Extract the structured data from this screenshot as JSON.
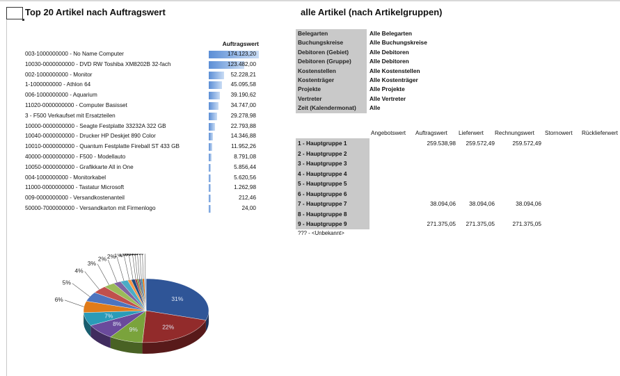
{
  "titles": {
    "left": "Top 20 Artikel nach Auftragswert",
    "right": "alle Artikel (nach Artikelgruppen)"
  },
  "top20": {
    "column_header": "Auftragswert",
    "rows": [
      {
        "label": "003-1000000000 - No Name Computer",
        "value": "174.123,20",
        "amount": 174123.2
      },
      {
        "label": "10030-0000000000 - DVD RW Toshiba XM8202B 32-fach",
        "value": "123.482,00",
        "amount": 123482.0
      },
      {
        "label": "002-1000000000 - Monitor",
        "value": "52.228,21",
        "amount": 52228.21
      },
      {
        "label": "1-1000000000 - Athlon 64",
        "value": "45.095,58",
        "amount": 45095.58
      },
      {
        "label": "006-1000000000 - Aquarium",
        "value": "39.190,62",
        "amount": 39190.62
      },
      {
        "label": "11020-0000000000 - Computer Basisset",
        "value": "34.747,00",
        "amount": 34747.0
      },
      {
        "label": "3 - F500 Verkaufset mit Ersatzteilen",
        "value": "29.278,98",
        "amount": 29278.98
      },
      {
        "label": "10000-0000000000 - Seagte Festplatte 33232A 322 GB",
        "value": "22.793,88",
        "amount": 22793.88
      },
      {
        "label": "10040-0000000000 - Drucker HP Deskjet 890 Color",
        "value": "14.346,88",
        "amount": 14346.88
      },
      {
        "label": "10010-0000000000 - Quantum Festplatte Fireball ST 433 GB",
        "value": "11.952,26",
        "amount": 11952.26
      },
      {
        "label": "40000-0000000000 - F500 - Modellauto",
        "value": "8.791,08",
        "amount": 8791.08
      },
      {
        "label": "10050-0000000000 - Grafikkarte All in One",
        "value": "5.856,44",
        "amount": 5856.44
      },
      {
        "label": "004-1000000000 - Monitorkabel",
        "value": "5.620,56",
        "amount": 5620.56
      },
      {
        "label": "11000-0000000000 - Tastatur Microsoft",
        "value": "1.262,98",
        "amount": 1262.98
      },
      {
        "label": "009-0000000000 - Versandkostenanteil",
        "value": "212,46",
        "amount": 212.46
      },
      {
        "label": "50000-7000000000 - Versandkarton mit Firmenlogo",
        "value": "24,00",
        "amount": 24.0
      }
    ]
  },
  "filters": [
    {
      "key": "Belegarten",
      "value": "Alle Belegarten"
    },
    {
      "key": "Buchungskreise",
      "value": "Alle Buchungskreise"
    },
    {
      "key": "Debitoren (Gebiet)",
      "value": "Alle Debitoren"
    },
    {
      "key": "Debitoren (Gruppe)",
      "value": "Alle Debitoren"
    },
    {
      "key": "Kostenstellen",
      "value": "Alle Kostenstellen"
    },
    {
      "key": "Kostenträger",
      "value": "Alle Kostenträger"
    },
    {
      "key": "Projekte",
      "value": "Alle Projekte"
    },
    {
      "key": "Vertreter",
      "value": "Alle Vertreter"
    },
    {
      "key": "Zeit (Kalendermonat)",
      "value": "Alle"
    }
  ],
  "groups_table": {
    "columns": [
      "Angebotswert",
      "Auftragswert",
      "Lieferwert",
      "Rechnungswert",
      "Stornowert",
      "Rücklieferwert"
    ],
    "rows": [
      {
        "name": "1 - Hauptgruppe 1",
        "auftragswert": "259.538,98",
        "lieferwert": "259.572,49",
        "rechnungswert": "259.572,49"
      },
      {
        "name": "2 - Hauptgruppe 2",
        "auftragswert": "",
        "lieferwert": "",
        "rechnungswert": ""
      },
      {
        "name": "3 - Hauptgruppe 3",
        "auftragswert": "",
        "lieferwert": "",
        "rechnungswert": ""
      },
      {
        "name": "4 - Hauptgruppe 4",
        "auftragswert": "",
        "lieferwert": "",
        "rechnungswert": ""
      },
      {
        "name": "5 - Hauptgruppe 5",
        "auftragswert": "",
        "lieferwert": "",
        "rechnungswert": ""
      },
      {
        "name": "6 - Hauptgruppe 6",
        "auftragswert": "",
        "lieferwert": "",
        "rechnungswert": ""
      },
      {
        "name": "7 - Hauptgruppe 7",
        "auftragswert": "38.094,06",
        "lieferwert": "38.094,06",
        "rechnungswert": "38.094,06"
      },
      {
        "name": "8 - Hauptgruppe 8",
        "auftragswert": "",
        "lieferwert": "",
        "rechnungswert": ""
      },
      {
        "name": "9 - Hauptgruppe 9",
        "auftragswert": "271.375,05",
        "lieferwert": "271.375,05",
        "rechnungswert": "271.375,05"
      }
    ],
    "unknown_row": "??? - <Unbekannt>"
  },
  "chart_data": {
    "type": "pie",
    "title": "",
    "slices": [
      {
        "label": "31%",
        "value": 31,
        "color": "#2f5597"
      },
      {
        "label": "22%",
        "value": 22,
        "color": "#922b2b"
      },
      {
        "label": "9%",
        "value": 9,
        "color": "#7aa33c"
      },
      {
        "label": "8%",
        "value": 8,
        "color": "#6a4a9c"
      },
      {
        "label": "7%",
        "value": 7,
        "color": "#2a9bb8"
      },
      {
        "label": "6%",
        "value": 6,
        "color": "#e07b1a"
      },
      {
        "label": "5%",
        "value": 5,
        "color": "#4d74bf"
      },
      {
        "label": "4%",
        "value": 4,
        "color": "#c0504d"
      },
      {
        "label": "3%",
        "value": 3,
        "color": "#9bbb59"
      },
      {
        "label": "2%",
        "value": 2,
        "color": "#8064a2"
      },
      {
        "label": "2%",
        "value": 2,
        "color": "#4bacc6"
      },
      {
        "label": "1%",
        "value": 1,
        "color": "#f79646"
      },
      {
        "label": "1%",
        "value": 1,
        "color": "#1f497d"
      },
      {
        "label": "0%",
        "value": 0.5,
        "color": "#a03030"
      },
      {
        "label": "0%",
        "value": 0.5,
        "color": "#77933c"
      },
      {
        "label": "0%",
        "value": 0.5,
        "color": "#604a7b"
      },
      {
        "label": "0%",
        "value": 0.5,
        "color": "#31859c"
      },
      {
        "label": "0%",
        "value": 0.5,
        "color": "#e46c0a"
      },
      {
        "label": "0%",
        "value": 0.5,
        "color": "#95b3d7"
      }
    ]
  }
}
